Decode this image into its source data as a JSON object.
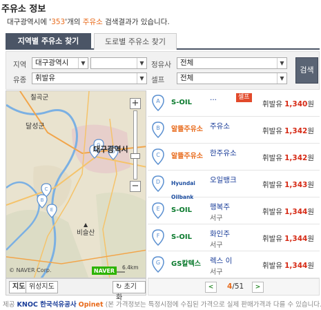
{
  "header": {
    "title": "주유소 정보",
    "summary_pre": "대구광역시에 '",
    "summary_count": "353",
    "summary_mid": "'개의 ",
    "summary_keyword": "주유소",
    "summary_post": " 검색결과가 있습니다."
  },
  "tabs": [
    {
      "label": "지역별 주유소 찾기",
      "active": true
    },
    {
      "label": "도로별 주유소 찾기",
      "active": false
    }
  ],
  "filters": {
    "region_label": "지역",
    "region_value": "대구광역시",
    "district_value": "",
    "brand_label": "정유사",
    "brand_value": "전체",
    "fuel_label": "유종",
    "fuel_value": "휘발유",
    "self_label": "셀프",
    "self_value": "전체",
    "search_label": "검색"
  },
  "map": {
    "place_labels": [
      "칠곡군",
      "달성군",
      "대구광역시",
      "비슬산"
    ],
    "copyright": "© NAVER Corp.",
    "scale": "6.4km",
    "brand": "NAVER",
    "markers": [
      "A",
      "B",
      "C",
      "D",
      "E",
      "F",
      "G"
    ],
    "view_map": "지도",
    "view_satellite": "위성지도",
    "reset": "초기화"
  },
  "results": [
    {
      "pin": "A",
      "brand": "S-OIL",
      "name": "...",
      "addr": "",
      "self": "셀프",
      "fuel": "휘발유",
      "price": "1,340",
      "unit": "원"
    },
    {
      "pin": "B",
      "brand": "알뜰주유소",
      "name": "주유소",
      "addr": "",
      "self": "",
      "fuel": "휘발유",
      "price": "1,342",
      "unit": "원"
    },
    {
      "pin": "C",
      "brand": "알뜰주유소",
      "name": "한주유소",
      "addr": "",
      "self": "",
      "fuel": "휘발유",
      "price": "1,342",
      "unit": "원"
    },
    {
      "pin": "D",
      "brand": "Hyundai Oilbank",
      "name": "오일뱅크",
      "addr": "",
      "self": "",
      "fuel": "휘발유",
      "price": "1,343",
      "unit": "원"
    },
    {
      "pin": "E",
      "brand": "S-OIL",
      "name": "행복주",
      "addr": "서구",
      "self": "",
      "fuel": "휘발유",
      "price": "1,344",
      "unit": "원"
    },
    {
      "pin": "F",
      "brand": "S-OIL",
      "name": "화인주",
      "addr": "서구",
      "self": "",
      "fuel": "휘발유",
      "price": "1,344",
      "unit": "원"
    },
    {
      "pin": "G",
      "brand": "GS칼텍스",
      "name": "렉스 이",
      "addr": "서구",
      "self": "",
      "fuel": "휘발유",
      "price": "1,344",
      "unit": "원"
    }
  ],
  "pager": {
    "current": "4",
    "total": "/51",
    "prev": "<",
    "next": ">"
  },
  "footer": {
    "prefix": "제공",
    "knoc": "KNOC 한국석유공사",
    "opinet": "Opinet",
    "note": "(본 가격정보는 특정시점에 수집된 가격으로 실제 판매가격과 다를 수 있습니다.)"
  },
  "colors": {
    "accent": "#e86a1a",
    "price": "#d62b16",
    "tab": "#4b5566",
    "pin": "#5a8fd0"
  }
}
